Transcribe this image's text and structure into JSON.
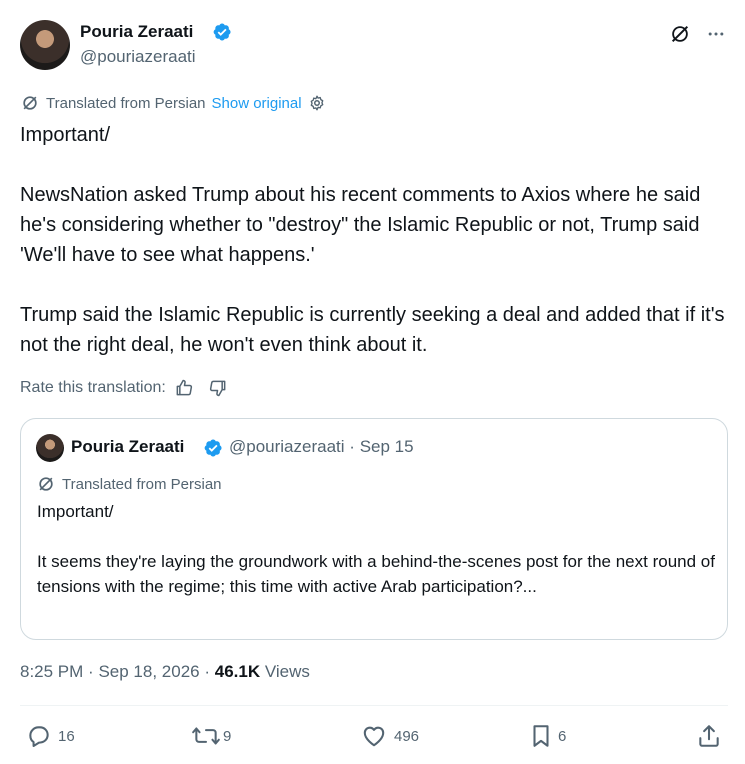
{
  "author": {
    "name": "Pouria Zeraati",
    "handle": "@pouriazeraati"
  },
  "translation": {
    "label": "Translated from Persian",
    "show_original": "Show original"
  },
  "tweet": {
    "line1": "Important/",
    "para2": "NewsNation asked Trump about his recent comments to Axios where he said he's considering whether to \"destroy\" the Islamic Republic or not, Trump said 'We'll have to see what happens.'",
    "para3": "Trump said the Islamic Republic is currently seeking a deal and added that if it's not the right deal, he won't even think about it."
  },
  "rate": {
    "label": "Rate this translation:"
  },
  "quote": {
    "name": "Pouria Zeraati",
    "handle": "@pouriazeraati",
    "separator": "·",
    "date": "Sep 15",
    "translated_label": "Translated from Persian",
    "line1": "Important/",
    "para2": "It seems they're laying the groundwork with a behind-the-scenes post for the next round of tensions with the regime; this time with active Arab participation?..."
  },
  "meta": {
    "time": "8:25 PM",
    "sep1": "·",
    "date": "Sep 18, 2026",
    "sep2": "·",
    "views_count": "46.1K",
    "views_label": "Views"
  },
  "actions": {
    "replies": "16",
    "reposts": "9",
    "likes": "496",
    "bookmarks": "6"
  },
  "colors": {
    "verified": "#1d9bf0",
    "link": "#1d9bf0",
    "secondary_text": "#536471"
  }
}
